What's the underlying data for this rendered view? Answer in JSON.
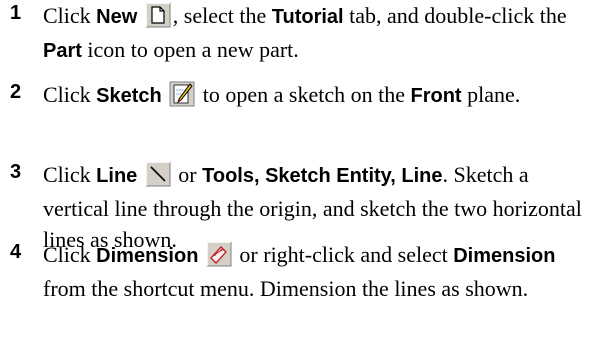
{
  "steps": [
    {
      "number": "1",
      "t1": "Click ",
      "b1": "New",
      "icon": "new-document-icon",
      "t2": ", select the ",
      "b2": "Tutorial",
      "t3": " tab, and double-click the ",
      "b3": "Part",
      "t4": " icon to open a new part."
    },
    {
      "number": "2",
      "t1": "Click ",
      "b1": "Sketch",
      "icon": "sketch-icon",
      "t2": " to open a sketch on the ",
      "b2": "Front",
      "t3": " plane."
    },
    {
      "number": "3",
      "t1": "Click ",
      "b1": "Line",
      "icon": "line-icon",
      "t2": " or ",
      "b2": "Tools, Sketch Entity, Line",
      "t3": ". Sketch a vertical line through the origin, and sketch the two horizontal lines as shown."
    },
    {
      "number": "4",
      "t1": "Click ",
      "b1": "Dimension",
      "icon": "dimension-icon",
      "t2": " or right-click and select ",
      "b2": "Dimension",
      "t3": " from the shortcut menu. Dimension the lines as shown."
    }
  ]
}
